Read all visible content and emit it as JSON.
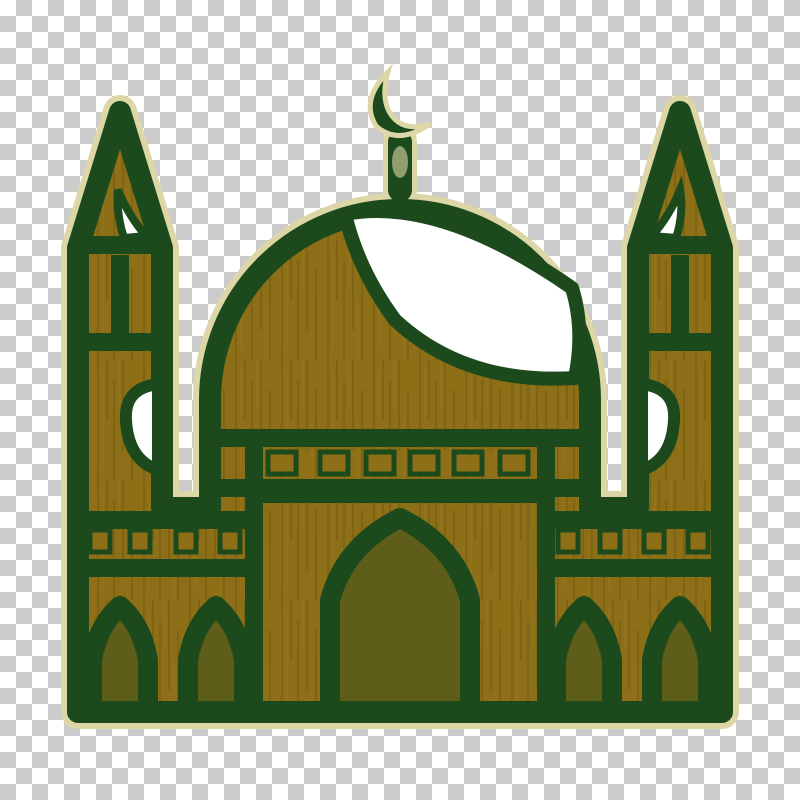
{
  "image": {
    "subject": "mosque-icon",
    "background": "transparency-checkerboard",
    "colors": {
      "checker_light": "#ffffff",
      "checker_dark": "#cccccc",
      "outline": "#1d4a1c",
      "wood": "#8c6f16",
      "wood_shade": "#6f5e15",
      "arch_fill": "#5e5e1a",
      "cream_border": "#ddd6a6",
      "grain": "#5a4710"
    }
  }
}
